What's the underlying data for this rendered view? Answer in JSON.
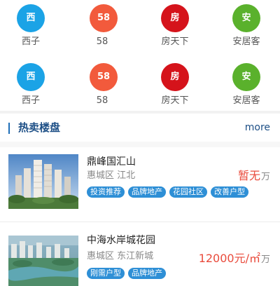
{
  "shortcuts_row1": [
    {
      "badge": "西",
      "label": "西子",
      "color": "#1ba3e6",
      "icon": "xi-icon"
    },
    {
      "badge": "58",
      "label": "58",
      "color": "#f25a3c",
      "icon": "58-icon"
    },
    {
      "badge": "房",
      "label": "房天下",
      "color": "#d5131b",
      "icon": "fang-icon"
    },
    {
      "badge": "安",
      "label": "安居客",
      "color": "#5ab12c",
      "icon": "an-icon"
    }
  ],
  "shortcuts_row2": [
    {
      "badge": "西",
      "label": "西子",
      "color": "#1ba3e6",
      "icon": "xi-icon"
    },
    {
      "badge": "58",
      "label": "58",
      "color": "#f25a3c",
      "icon": "58-icon"
    },
    {
      "badge": "房",
      "label": "房天下",
      "color": "#d5131b",
      "icon": "fang-icon"
    },
    {
      "badge": "安",
      "label": "安居客",
      "color": "#5ab12c",
      "icon": "an-icon"
    }
  ],
  "section": {
    "title": "热卖楼盘",
    "more": "more"
  },
  "listings": [
    {
      "name": "鼎峰国汇山",
      "location": "惠城区 江北",
      "price": "暂无",
      "unit": "万",
      "tags": [
        "投资推荐",
        "品牌地产",
        "花园社区",
        "改善户型"
      ]
    },
    {
      "name": "中海水岸城花园",
      "location": "惠城区 东江新城",
      "price": "12000元/㎡",
      "unit": "万",
      "tags": [
        "刚需户型",
        "品牌地产"
      ]
    }
  ],
  "colors": {
    "accent": "#1d4f86",
    "price": "#e94b3c",
    "tag": "#2e8fd6"
  }
}
